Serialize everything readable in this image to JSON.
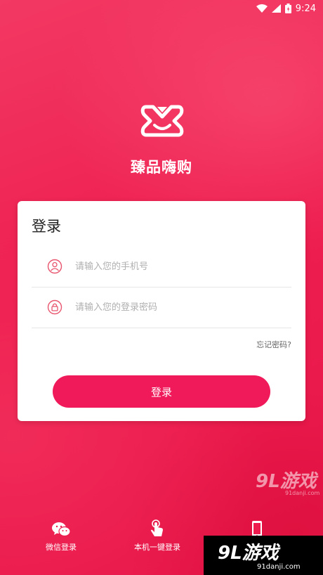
{
  "status_bar": {
    "time": "9:24",
    "icons": [
      "wifi-icon",
      "signal-icon",
      "battery-icon"
    ]
  },
  "app": {
    "name": "臻品嗨购",
    "logo_icon": "app-logo-icon",
    "brand_color": "#ee1b4f"
  },
  "login_card": {
    "title": "登录",
    "phone_placeholder": "请输入您的手机号",
    "password_placeholder": "请输入您的登录密码",
    "forgot_password": "忘记密码?",
    "login_button": "登录",
    "button_color": "#f0195a"
  },
  "bottom_options": [
    {
      "label": "微信登录",
      "icon": "wechat-icon"
    },
    {
      "label": "本机一键登录",
      "icon": "tap-hand-icon"
    },
    {
      "label": "",
      "icon": "phone-icon"
    }
  ],
  "watermark": {
    "logo": "9L游戏",
    "domain": "91danji.com"
  }
}
